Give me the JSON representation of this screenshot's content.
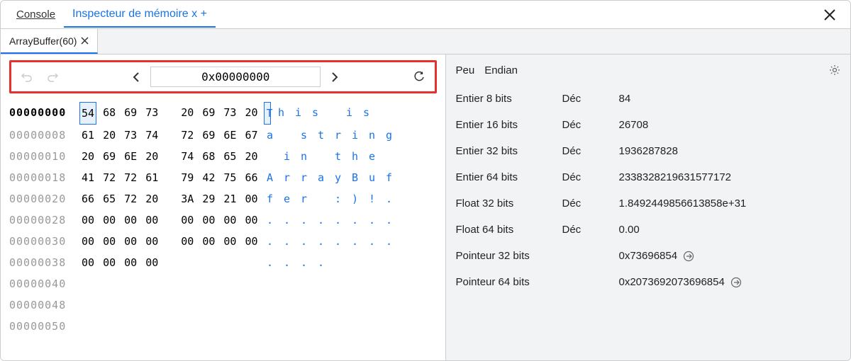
{
  "tabs": {
    "console": "Console",
    "inspector": "Inspecteur de mémoire x +"
  },
  "subtab": {
    "label": "ArrayBuffer(60)"
  },
  "address_bar": {
    "value": "0x00000000"
  },
  "hex_rows": [
    {
      "addr": "00000000",
      "bytes": [
        "54",
        "68",
        "69",
        "73",
        "20",
        "69",
        "73",
        "20"
      ],
      "ascii": [
        "T",
        "h",
        "i",
        "s",
        " ",
        "i",
        "s",
        " "
      ],
      "sel": 0,
      "bold": true
    },
    {
      "addr": "00000008",
      "bytes": [
        "61",
        "20",
        "73",
        "74",
        "72",
        "69",
        "6E",
        "67"
      ],
      "ascii": [
        "a",
        " ",
        "s",
        "t",
        "r",
        "i",
        "n",
        "g"
      ]
    },
    {
      "addr": "00000010",
      "bytes": [
        "20",
        "69",
        "6E",
        "20",
        "74",
        "68",
        "65",
        "20"
      ],
      "ascii": [
        " ",
        "i",
        "n",
        " ",
        "t",
        "h",
        "e",
        " "
      ]
    },
    {
      "addr": "00000018",
      "bytes": [
        "41",
        "72",
        "72",
        "61",
        "79",
        "42",
        "75",
        "66"
      ],
      "ascii": [
        "A",
        "r",
        "r",
        "a",
        "y",
        "B",
        "u",
        "f"
      ]
    },
    {
      "addr": "00000020",
      "bytes": [
        "66",
        "65",
        "72",
        "20",
        "3A",
        "29",
        "21",
        "00"
      ],
      "ascii": [
        "f",
        "e",
        "r",
        " ",
        ":",
        ")",
        "!",
        "."
      ]
    },
    {
      "addr": "00000028",
      "bytes": [
        "00",
        "00",
        "00",
        "00",
        "00",
        "00",
        "00",
        "00"
      ],
      "ascii": [
        ".",
        ".",
        ".",
        ".",
        ".",
        ".",
        ".",
        "."
      ]
    },
    {
      "addr": "00000030",
      "bytes": [
        "00",
        "00",
        "00",
        "00",
        "00",
        "00",
        "00",
        "00"
      ],
      "ascii": [
        ".",
        ".",
        ".",
        ".",
        ".",
        ".",
        ".",
        "."
      ]
    },
    {
      "addr": "00000038",
      "bytes": [
        "00",
        "00",
        "00",
        "00"
      ],
      "ascii": [
        ".",
        ".",
        ".",
        "."
      ]
    },
    {
      "addr": "00000040",
      "bytes": [],
      "ascii": []
    },
    {
      "addr": "00000048",
      "bytes": [],
      "ascii": []
    },
    {
      "addr": "00000050",
      "bytes": [],
      "ascii": []
    }
  ],
  "right": {
    "endian_a": "Peu",
    "endian_b": "Endian",
    "rows": [
      {
        "label": "Entier 8 bits",
        "fmt": "Déc",
        "val": "84"
      },
      {
        "label": "Entier 16 bits",
        "fmt": "Déc",
        "val": "26708"
      },
      {
        "label": "Entier 32 bits",
        "fmt": "Déc",
        "val": "1936287828"
      },
      {
        "label": "Entier 64 bits",
        "fmt": "Déc",
        "val": "2338328219631577172"
      },
      {
        "label": "Float 32 bits",
        "fmt": "Déc",
        "val": "1.8492449856613858e+31"
      },
      {
        "label": "Float 64 bits",
        "fmt": "Déc",
        "val": "0.00"
      },
      {
        "label": "Pointeur 32 bits",
        "fmt": "",
        "val": "0x73696854",
        "goto": true
      },
      {
        "label": "Pointeur 64 bits",
        "fmt": "",
        "val": "0x2073692073696854",
        "goto": true
      }
    ]
  }
}
